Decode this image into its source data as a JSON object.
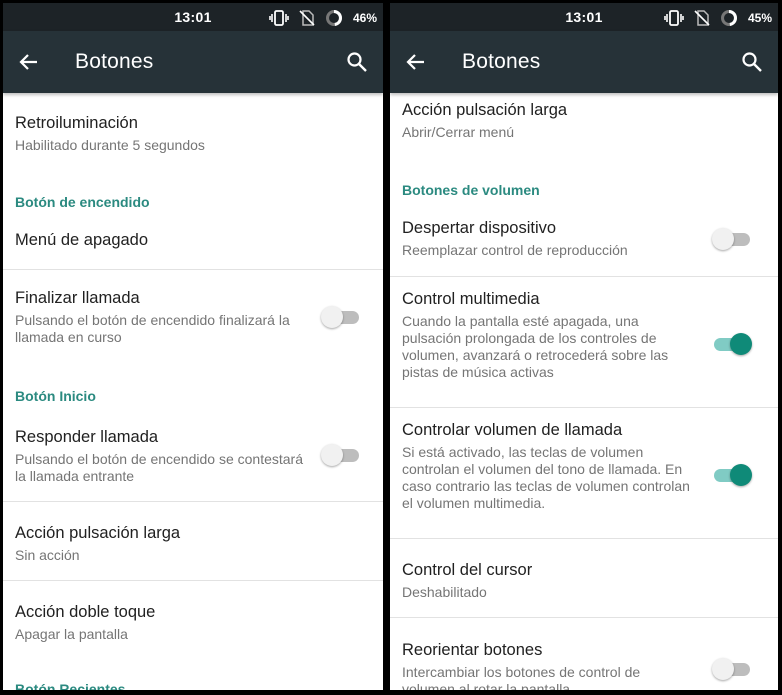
{
  "left": {
    "status": {
      "time": "13:01",
      "battery": "46%"
    },
    "title": "Botones",
    "rows": {
      "backlight": {
        "title": "Retroiluminación",
        "summary": "Habilitado durante 5 segundos"
      },
      "power_section": "Botón de encendido",
      "power_menu": {
        "title": "Menú de apagado"
      },
      "end_call": {
        "title": "Finalizar llamada",
        "summary": "Pulsando el botón de encendido finalizará la llamada en curso",
        "enabled": false
      },
      "home_section": "Botón Inicio",
      "answer_call": {
        "title": "Responder llamada",
        "summary": "Pulsando el botón de encendido se contestará la llamada entrante",
        "enabled": false
      },
      "long_press": {
        "title": "Acción pulsación larga",
        "summary": "Sin acción"
      },
      "double_tap": {
        "title": "Acción doble toque",
        "summary": "Apagar la pantalla"
      },
      "recents_section": "Botón Recientes"
    }
  },
  "right": {
    "status": {
      "time": "13:01",
      "battery": "45%"
    },
    "title": "Botones",
    "rows": {
      "long_press": {
        "title": "Acción pulsación larga",
        "summary": "Abrir/Cerrar menú"
      },
      "volume_section": "Botones de volumen",
      "wake_device": {
        "title": "Despertar dispositivo",
        "summary": "Reemplazar control de reproducción",
        "enabled": false
      },
      "media_control": {
        "title": "Control multimedia",
        "summary": "Cuando la pantalla esté apagada, una pulsación prolongada de los controles de volumen, avanzará o retrocederá sobre las pistas de música activas",
        "enabled": true
      },
      "ring_volume": {
        "title": "Controlar volumen de llamada",
        "summary": "Si está activado, las teclas de volumen controlan el volumen del tono de llamada. En caso contrario las teclas de volumen controlan el volumen multimedia.",
        "enabled": true
      },
      "cursor_control": {
        "title": "Control del cursor",
        "summary": "Deshabilitado"
      },
      "reorient": {
        "title": "Reorientar botones",
        "summary": "Intercambiar los botones de control de volumen al rotar la pantalla",
        "enabled": false
      }
    }
  },
  "colors": {
    "statusbar": "#1d2327",
    "appbar": "#263238",
    "accent": "#2b8a80",
    "toggle_on": "#0f8a78"
  },
  "icons": {
    "back": "arrow-left-icon",
    "search": "search-icon",
    "vibrate": "vibrate-icon",
    "no_sim": "no-sim-icon",
    "battery": "battery-ring-icon"
  }
}
